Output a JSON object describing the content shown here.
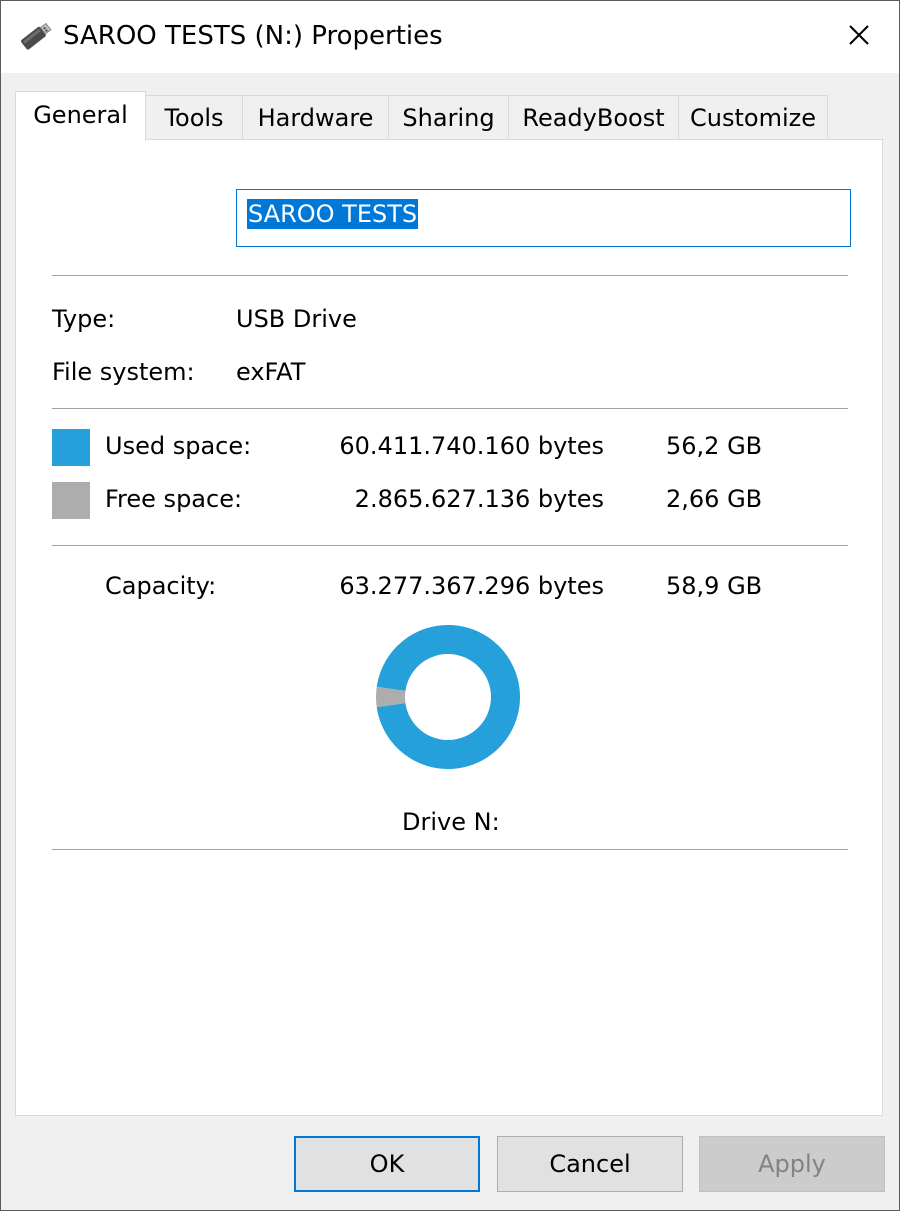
{
  "window": {
    "title": "SAROO TESTS (N:) Properties"
  },
  "tabs": [
    {
      "label": "General",
      "active": true
    },
    {
      "label": "Tools",
      "active": false
    },
    {
      "label": "Hardware",
      "active": false
    },
    {
      "label": "Sharing",
      "active": false
    },
    {
      "label": "ReadyBoost",
      "active": false
    },
    {
      "label": "Customize",
      "active": false
    }
  ],
  "general": {
    "drive_name": "SAROO TESTS",
    "type_label": "Type:",
    "type_value": "USB Drive",
    "fs_label": "File system:",
    "fs_value": "exFAT",
    "used_label": "Used space:",
    "used_bytes": "60.411.740.160 bytes",
    "used_gb": "56,2 GB",
    "free_label": "Free space:",
    "free_bytes": "2.865.627.136 bytes",
    "free_gb": "2,66 GB",
    "capacity_label": "Capacity:",
    "capacity_bytes": "63.277.367.296 bytes",
    "capacity_gb": "58,9 GB",
    "drive_caption": "Drive N:"
  },
  "usage": {
    "used_fraction": 0.9547,
    "used_color": "#26a0da",
    "free_color": "#adadad"
  },
  "icons": {
    "title": "usb-drive-icon",
    "close": "close-icon"
  },
  "buttons": {
    "ok": "OK",
    "cancel": "Cancel",
    "apply": "Apply"
  }
}
